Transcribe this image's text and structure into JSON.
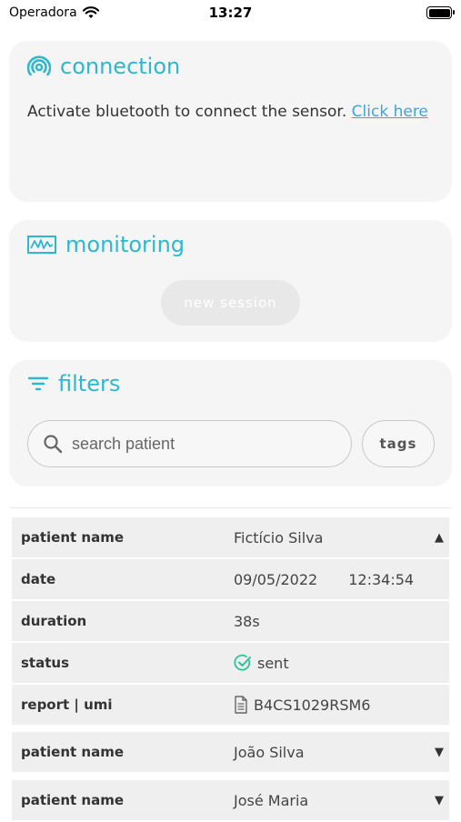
{
  "status_bar": {
    "carrier": "Operadora",
    "time": "13:27"
  },
  "connection": {
    "title": "connection",
    "message": "Activate bluetooth to connect the sensor.",
    "link": "Click here"
  },
  "monitoring": {
    "title": "monitoring",
    "button": "new session"
  },
  "filters": {
    "title": "filters",
    "search_placeholder": "search patient",
    "tags_label": "tags"
  },
  "expanded_record": {
    "patient_label": "patient name",
    "patient": "Fictício Silva",
    "date_label": "date",
    "date": "09/05/2022",
    "time": "12:34:54",
    "duration_label": "duration",
    "duration": "38s",
    "status_label": "status",
    "status": "sent",
    "report_label": "report | umi",
    "report": "B4CS1029RSM6"
  },
  "collapsed_records": [
    {
      "label": "patient name",
      "patient": "João Silva"
    },
    {
      "label": "patient name",
      "patient": "José Maria"
    }
  ],
  "colors": {
    "accent": "#2fb8cc",
    "status_ok": "#2fc29a",
    "link": "#3aa7d6"
  }
}
